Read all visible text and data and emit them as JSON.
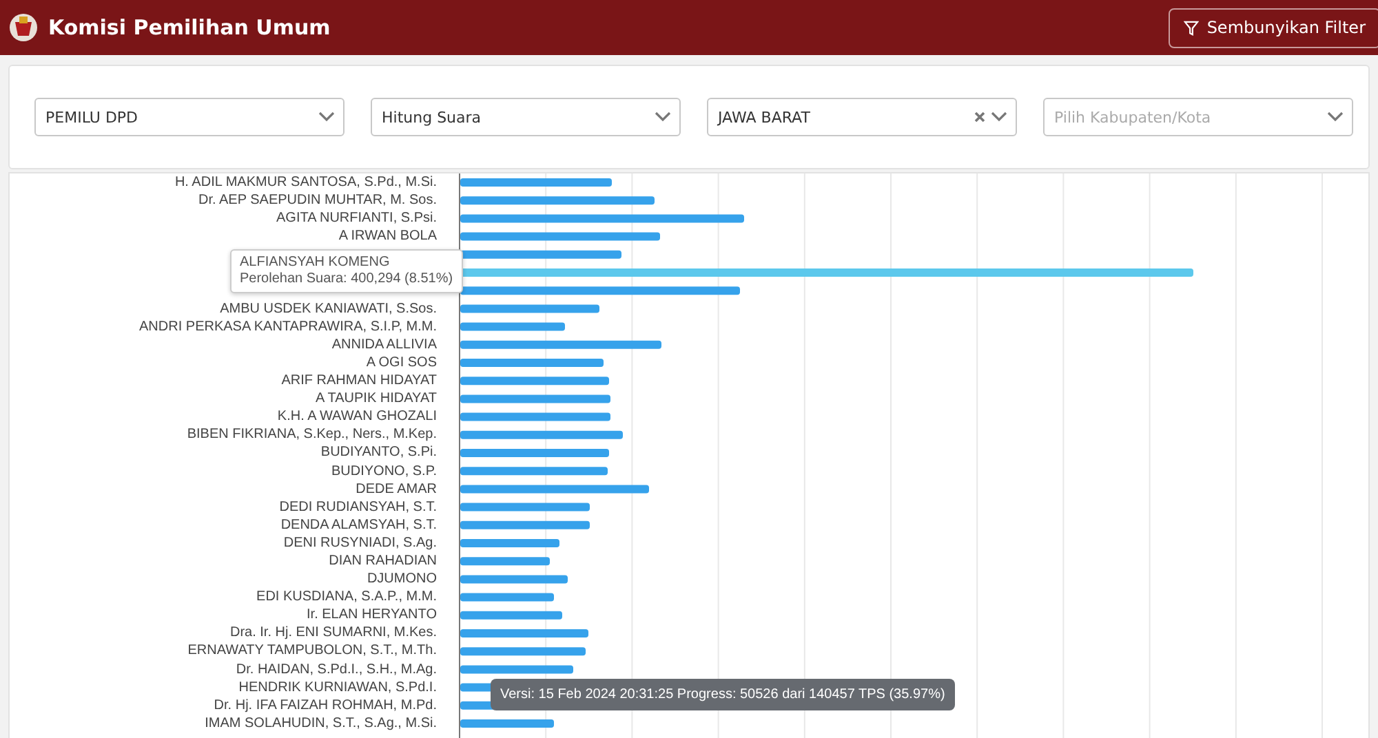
{
  "header": {
    "title": "Komisi Pemilihan Umum",
    "filter_button": "Sembunyikan Filter"
  },
  "filters": [
    {
      "value": "PEMILU DPD",
      "clearable": false
    },
    {
      "value": "Hitung Suara",
      "clearable": false
    },
    {
      "value": "JAWA BARAT",
      "clearable": true
    },
    {
      "placeholder": "Pilih Kabupaten/Kota",
      "clearable": false
    }
  ],
  "candidates": [
    {
      "name": "H. ADIL MAKMUR SANTOSA, S.Pd., M.Si.",
      "highlighted": false
    },
    {
      "name": "Dr. AEP SAEPUDIN MUHTAR, M. Sos.",
      "highlighted": false
    },
    {
      "name": "AGITA NURFIANTI, S.Psi.",
      "highlighted": false
    },
    {
      "name": "A IRWAN BOLA",
      "highlighted": false
    },
    {
      "highlighted": false
    },
    {
      "highlighted": true
    },
    {
      "highlighted": false
    },
    {
      "name": "AMBU USDEK KANIAWATI, S.Sos.",
      "highlighted": false
    },
    {
      "name": "ANDRI PERKASA KANTAPRAWIRA, S.I.P, M.M.",
      "highlighted": false
    },
    {
      "name": "ANNIDA ALLIVIA",
      "highlighted": false
    },
    {
      "name": "A OGI SOS",
      "highlighted": false
    },
    {
      "name": "ARIF RAHMAN HIDAYAT",
      "highlighted": false
    },
    {
      "name": "A TAUPIK HIDAYAT",
      "highlighted": false
    },
    {
      "name": "K.H. A WAWAN GHOZALI",
      "highlighted": false
    },
    {
      "name": "BIBEN FIKRIANA, S.Kep., Ners., M.Kep.",
      "highlighted": false
    },
    {
      "name": "BUDIYANTO, S.Pi.",
      "highlighted": false
    },
    {
      "name": "BUDIYONO, S.P.",
      "highlighted": false
    },
    {
      "name": "DEDE AMAR",
      "highlighted": false
    },
    {
      "name": "DEDI RUDIANSYAH, S.T.",
      "highlighted": false
    },
    {
      "name": "DENDA ALAMSYAH, S.T.",
      "highlighted": false
    },
    {
      "name": "DENI RUSYNIADI, S.Ag.",
      "highlighted": false
    },
    {
      "name": "DIAN RAHADIAN",
      "highlighted": false
    },
    {
      "name": "DJUMONO",
      "highlighted": false
    },
    {
      "name": "EDI KUSDIANA, S.A.P., M.M.",
      "highlighted": false
    },
    {
      "name": "Ir. ELAN HERYANTO",
      "highlighted": false
    },
    {
      "name": "Dra. Ir. Hj. ENI SUMARNI, M.Kes.",
      "highlighted": false
    },
    {
      "name": "ERNAWATY TAMPUBOLON, S.T., M.Th.",
      "highlighted": false
    },
    {
      "name": "Dr. HAIDAN, S.Pd.I., S.H., M.Ag.",
      "highlighted": false
    },
    {
      "name": "HENDRIK KURNIAWAN, S.Pd.I.",
      "highlighted": false
    },
    {
      "name": "Dr. Hj. IFA FAIZAH ROHMAH, M.Pd.",
      "highlighted": false
    },
    {
      "name": "IMAM SOLAHUDIN, S.T., S.Ag., M.Si.",
      "highlighted": false
    }
  ],
  "tooltip": {
    "name": "ALFIANSYAH KOMENG",
    "detail": "Perolehan Suara: 400,294 (8.51%)"
  },
  "version_note": "Versi: 15 Feb 2024 20:31:25 Progress: 50526 dari 140457 TPS (35.97%)"
}
